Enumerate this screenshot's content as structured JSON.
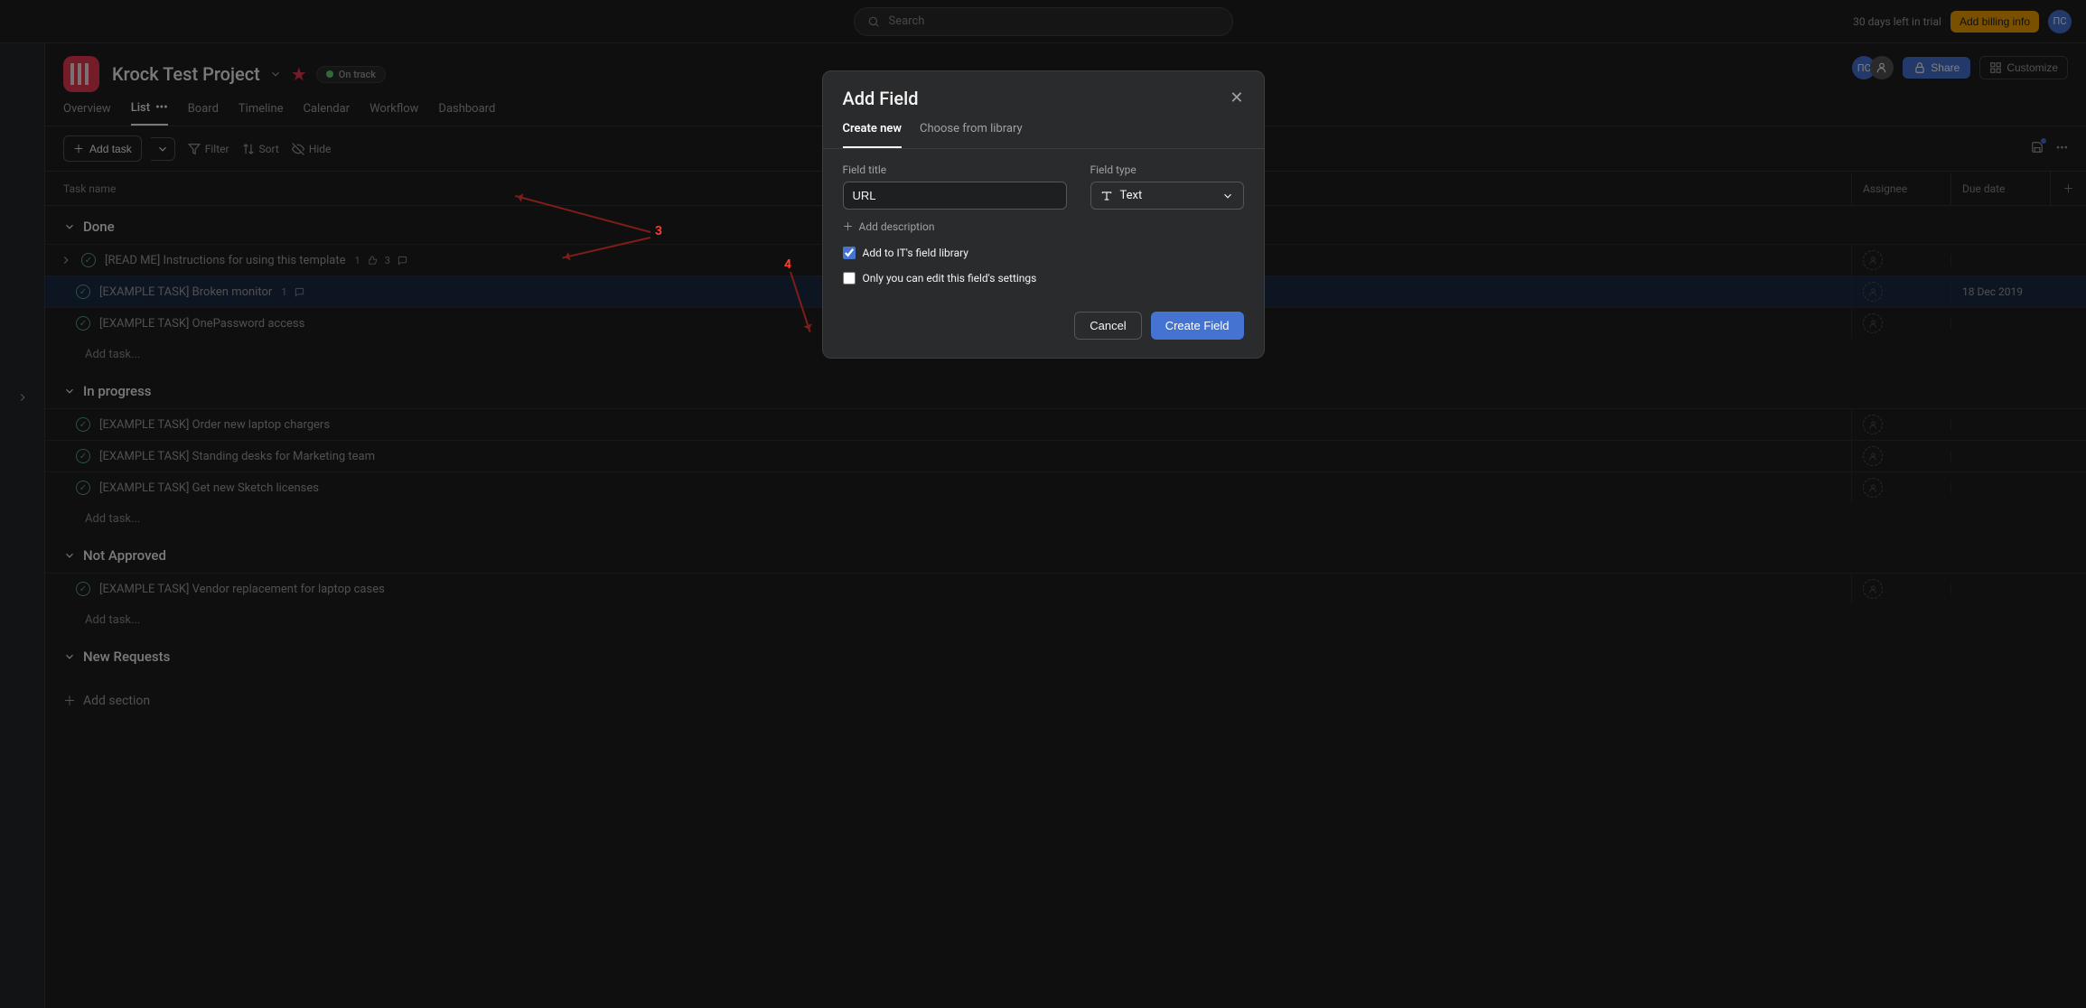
{
  "topbar": {
    "search_placeholder": "Search",
    "trial_text": "30 days left in trial",
    "billing_button": "Add billing info",
    "avatar_initials": "ПС"
  },
  "project": {
    "title": "Krock Test Project",
    "status_label": "On track",
    "share_label": "Share",
    "customize_label": "Customize"
  },
  "tabs": {
    "overview": "Overview",
    "list": "List",
    "board": "Board",
    "timeline": "Timeline",
    "calendar": "Calendar",
    "workflow": "Workflow",
    "dashboard": "Dashboard"
  },
  "toolbar": {
    "add_task": "Add task",
    "filter": "Filter",
    "sort": "Sort",
    "hide": "Hide"
  },
  "columns": {
    "task_name": "Task name",
    "assignee": "Assignee",
    "due_date": "Due date"
  },
  "sections": {
    "done": "Done",
    "in_progress": "In progress",
    "not_approved": "Not Approved",
    "new_requests": "New Requests",
    "add_task": "Add task...",
    "add_section": "Add section"
  },
  "tasks": {
    "done": [
      {
        "name": "[READ ME] Instructions for using this template",
        "likes": "1",
        "comments": "3",
        "due": ""
      },
      {
        "name": "[EXAMPLE TASK] Broken monitor",
        "likes": "",
        "comments": "1",
        "due": "18 Dec 2019"
      },
      {
        "name": "[EXAMPLE TASK] OnePassword access",
        "likes": "",
        "comments": "",
        "due": ""
      }
    ],
    "in_progress": [
      {
        "name": "[EXAMPLE TASK] Order new laptop chargers"
      },
      {
        "name": "[EXAMPLE TASK] Standing desks for Marketing team"
      },
      {
        "name": "[EXAMPLE TASK] Get new Sketch licenses"
      }
    ],
    "not_approved": [
      {
        "name": "[EXAMPLE TASK] Vendor replacement for laptop cases"
      }
    ]
  },
  "modal": {
    "title": "Add Field",
    "tab_create": "Create new",
    "tab_library": "Choose from library",
    "field_title_label": "Field title",
    "field_title_value": "URL",
    "field_type_label": "Field type",
    "field_type_value": "Text",
    "add_description": "Add description",
    "add_to_library": "Add to IT's field library",
    "only_you": "Only you can edit this field's settings",
    "cancel": "Cancel",
    "create": "Create Field"
  },
  "annotations": {
    "three": "3",
    "four": "4"
  }
}
